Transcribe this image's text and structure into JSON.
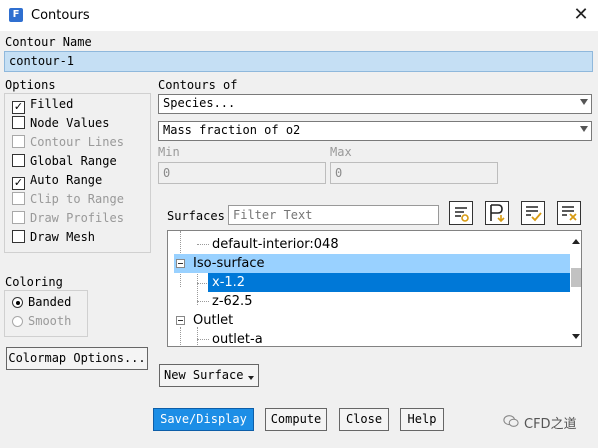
{
  "window": {
    "title": "Contours",
    "app_icon_letter": "F",
    "close_glyph": "✕"
  },
  "contour_name": {
    "label": "Contour Name",
    "value": "contour-1"
  },
  "options": {
    "label": "Options",
    "items": [
      {
        "label": "Filled",
        "checked": true,
        "enabled": true
      },
      {
        "label": "Node Values",
        "checked": false,
        "enabled": true
      },
      {
        "label": "Contour Lines",
        "checked": false,
        "enabled": false
      },
      {
        "label": "Global Range",
        "checked": false,
        "enabled": true
      },
      {
        "label": "Auto Range",
        "checked": true,
        "enabled": true
      },
      {
        "label": "Clip to Range",
        "checked": false,
        "enabled": false
      },
      {
        "label": "Draw Profiles",
        "checked": false,
        "enabled": false
      },
      {
        "label": "Draw Mesh",
        "checked": false,
        "enabled": true
      }
    ]
  },
  "coloring": {
    "label": "Coloring",
    "options": [
      {
        "label": "Banded",
        "selected": true,
        "enabled": true
      },
      {
        "label": "Smooth",
        "selected": false,
        "enabled": false
      }
    ]
  },
  "colormap_button": "Colormap Options...",
  "contours_of": {
    "label": "Contours of",
    "category": "Species...",
    "variable": "Mass fraction of o2"
  },
  "range": {
    "min_label": "Min",
    "min_value": "0",
    "max_label": "Max",
    "max_value": "0"
  },
  "surfaces": {
    "label": "Surfaces",
    "filter_placeholder": "Filter Text",
    "toolbar_icons": [
      "surface-options-icon",
      "surface-group-icon",
      "select-all-icon",
      "deselect-all-icon"
    ],
    "tree": [
      {
        "label": "default-interior:048",
        "level": 1,
        "state": "none"
      },
      {
        "label": "Iso-surface",
        "level": 0,
        "state": "partial",
        "expanded": true
      },
      {
        "label": "x-1.2",
        "level": 1,
        "state": "selected"
      },
      {
        "label": "z-62.5",
        "level": 1,
        "state": "none"
      },
      {
        "label": "Outlet",
        "level": 0,
        "state": "none",
        "expanded": true
      },
      {
        "label": "outlet-a",
        "level": 1,
        "state": "none"
      }
    ]
  },
  "new_surface_button": "New Surface",
  "footer": {
    "save_display": "Save/Display",
    "compute": "Compute",
    "close": "Close",
    "help": "Help"
  },
  "watermark": {
    "text": "CFD之道"
  },
  "colors": {
    "primary_button": "#1c8ee6",
    "name_field": "#c5dff4",
    "tree_selected": "#0078d7",
    "tree_partial": "#99d1ff"
  }
}
